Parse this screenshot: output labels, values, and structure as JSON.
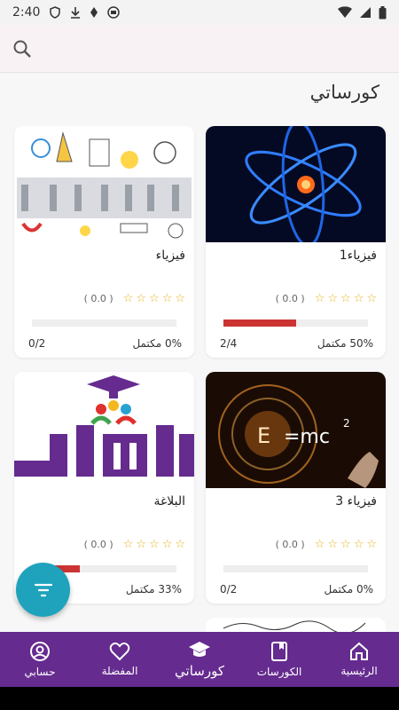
{
  "status_bar": {
    "time": "2:40"
  },
  "search": {
    "icon": "search-icon"
  },
  "page": {
    "title": "كورساتي"
  },
  "courses": [
    {
      "title": "فيزياء1",
      "rating": "( 0.0 )",
      "progress": 0.5,
      "percent_text": "50% مكتمل",
      "count": "2/4",
      "image": "atom-blue"
    },
    {
      "title": "فيزياء",
      "rating": "( 0.0 )",
      "progress": 0.0,
      "percent_text": "0% مكتمل",
      "count": "0/2",
      "image": "physics-doodle"
    },
    {
      "title": "فيزياء 3",
      "rating": "( 0.0 )",
      "progress": 0.0,
      "percent_text": "0% مكتمل",
      "count": "0/2",
      "image": "emc2"
    },
    {
      "title": "البلاغة",
      "rating": "( 0.0 )",
      "progress": 0.33,
      "percent_text": "33% مكتمل",
      "count": "",
      "image": "graduation-logo"
    }
  ],
  "bottom_nav": [
    {
      "label": "الرئيسية",
      "icon": "home-icon"
    },
    {
      "label": "الكورسات",
      "icon": "book-icon"
    },
    {
      "label": "كورساتي",
      "icon": "graduation-cap-icon",
      "active": true
    },
    {
      "label": "المفضلة",
      "icon": "heart-icon"
    },
    {
      "label": "حسابي",
      "icon": "account-icon"
    }
  ],
  "colors": {
    "nav": "#652b8f",
    "fab": "#1fa3bd",
    "progress": "#cc3333",
    "star": "#e6b422"
  }
}
